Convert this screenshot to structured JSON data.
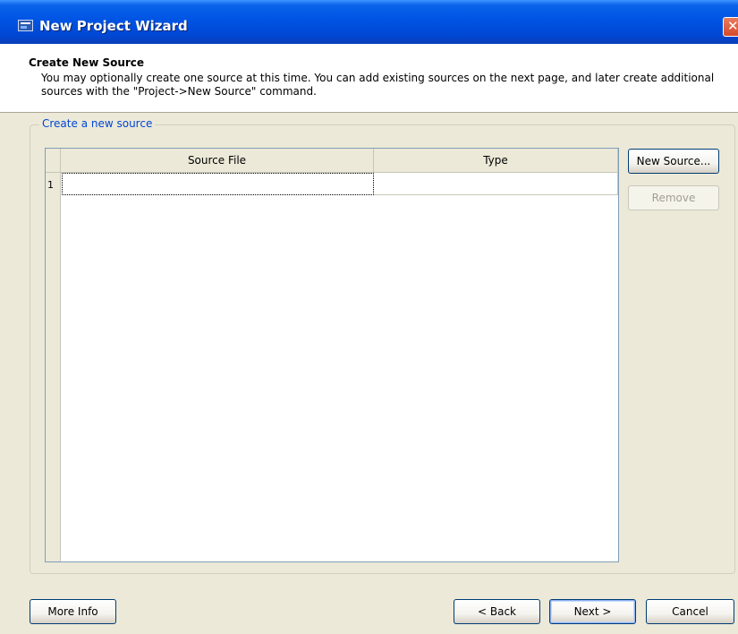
{
  "window": {
    "title": "New Project Wizard",
    "icon": "app-icon",
    "close_glyph": "✕"
  },
  "header": {
    "title": "Create New Source",
    "description": "You may optionally create one source at this time. You can add existing sources on the next page, and later create additional sources with the \"Project->New Source\" command."
  },
  "group": {
    "legend": "Create a new source"
  },
  "table": {
    "columns": [
      "Source File",
      "Type"
    ],
    "rows": [
      {
        "num": "1",
        "source_file": "",
        "type": ""
      }
    ]
  },
  "side_buttons": {
    "new_source": "New Source...",
    "remove": "Remove"
  },
  "footer": {
    "more_info": "More Info",
    "back": "< Back",
    "next": "Next >",
    "cancel": "Cancel"
  },
  "colors": {
    "titlebar": "#0054e3",
    "dialog_bg": "#ece9d8",
    "legend_text": "#0046d5",
    "button_border": "#003c74"
  }
}
